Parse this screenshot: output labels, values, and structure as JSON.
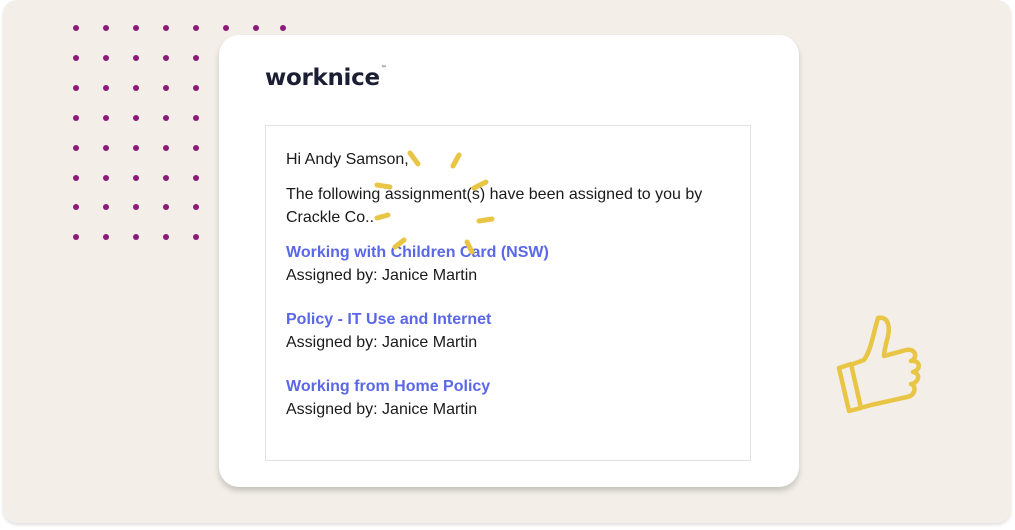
{
  "brand": {
    "logo_text": "worknice",
    "trademark": "™",
    "accent_color": "#5a67e6",
    "dot_color": "#8b1a78",
    "doodle_color": "#e8c544",
    "background_color": "#f3eee8"
  },
  "email": {
    "greeting": "Hi Andy Samson,",
    "intro": "The following assignment(s) have been assigned to you by Crackle Co..",
    "assignments": [
      {
        "title": "Working with Children Card (NSW)",
        "assigned_by": "Assigned by: Janice Martin"
      },
      {
        "title": "Policy - IT Use and Internet",
        "assigned_by": "Assigned by: Janice Martin"
      },
      {
        "title": "Working from Home Policy",
        "assigned_by": "Assigned by: Janice Martin"
      }
    ]
  },
  "decorations": {
    "sparkle_icon": "sparkle-icon",
    "thumbs_up_icon": "thumbs-up-icon"
  }
}
